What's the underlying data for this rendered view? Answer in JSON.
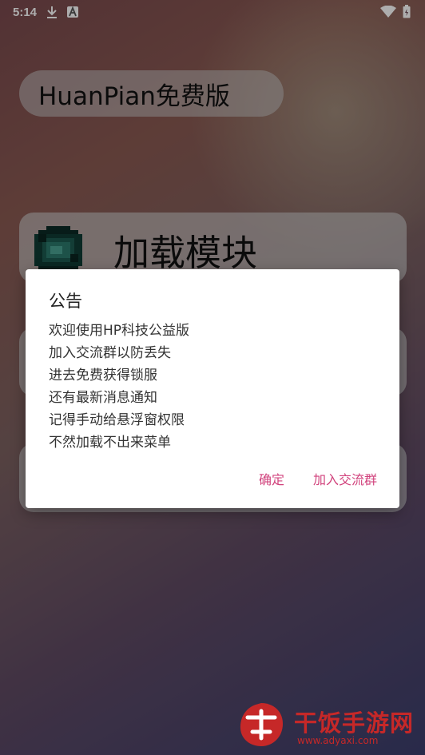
{
  "status_bar": {
    "time": "5:14",
    "icons": [
      "download-icon",
      "a-icon",
      "wifi-icon",
      "battery-icon"
    ]
  },
  "app": {
    "title": "HuanPian免费版",
    "load_module_label": "加载模块"
  },
  "dialog": {
    "title": "公告",
    "lines": [
      "欢迎使用HP科技公益版",
      "加入交流群以防丢失",
      "进去免费获得锁服",
      "还有最新消息通知",
      "记得手动给悬浮窗权限",
      "不然加载不出来菜单"
    ],
    "confirm_label": "确定",
    "join_group_label": "加入交流群"
  },
  "watermark": {
    "text": "干饭手游网",
    "url": "www.adyaxi.com"
  },
  "colors": {
    "accent": "#d1427c",
    "watermark": "#c62828"
  }
}
